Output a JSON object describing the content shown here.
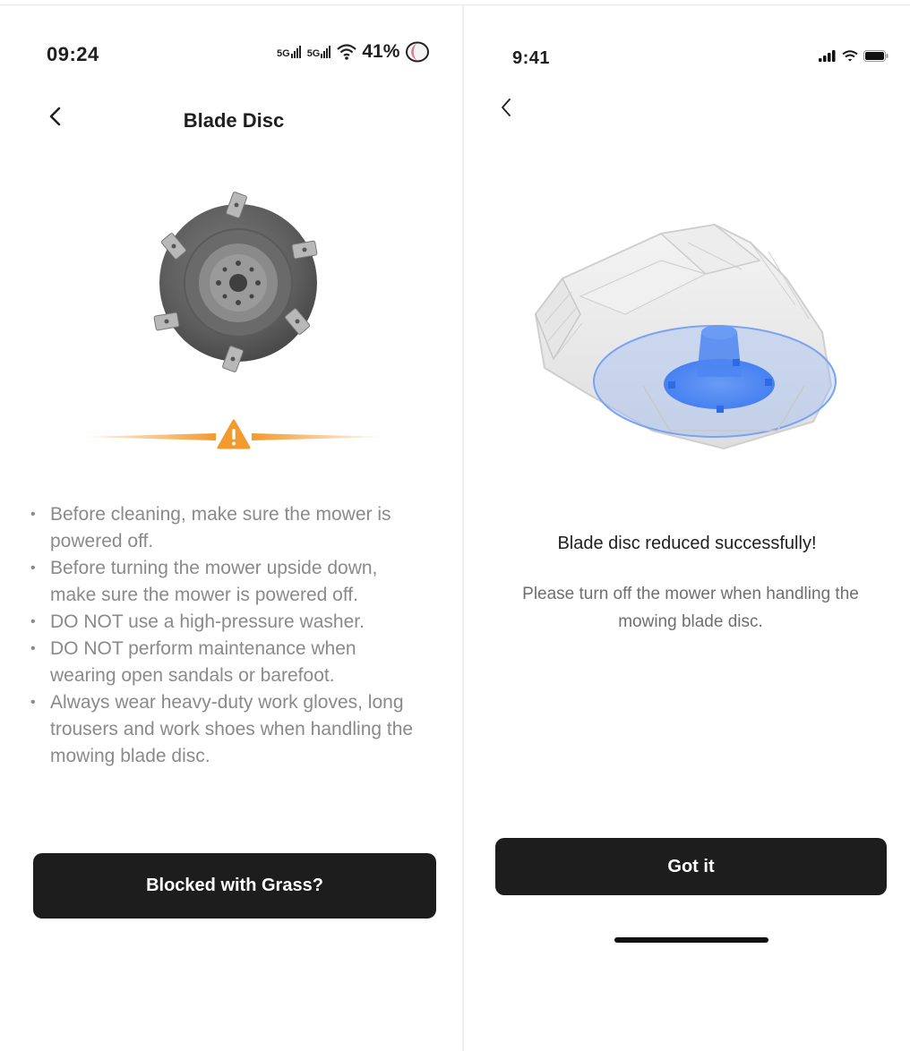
{
  "left_screen": {
    "status_bar": {
      "time": "09:24",
      "network_1": "5G",
      "network_2": "5G",
      "battery": "41%"
    },
    "header": {
      "title": "Blade Disc"
    },
    "warnings": [
      "Before cleaning, make sure the mower is powered off.",
      "Before turning the mower upside down, make sure the mower is powered off.",
      "DO NOT use a high-pressure washer.",
      "DO NOT perform maintenance when wearing open sandals or barefoot.",
      "Always wear heavy-duty work gloves, long trousers and work shoes when handling the mowing blade disc."
    ],
    "button": {
      "label": "Blocked with Grass?"
    }
  },
  "right_screen": {
    "status_bar": {
      "time": "9:41"
    },
    "message": {
      "title": "Blade disc reduced successfully!",
      "body": "Please turn off the mower when handling the mowing blade disc."
    },
    "button": {
      "label": "Got it"
    }
  },
  "colors": {
    "button_bg": "#1d1d1d",
    "warning_orange": "#f29a2e",
    "highlight_blue": "#3f7cf0"
  }
}
